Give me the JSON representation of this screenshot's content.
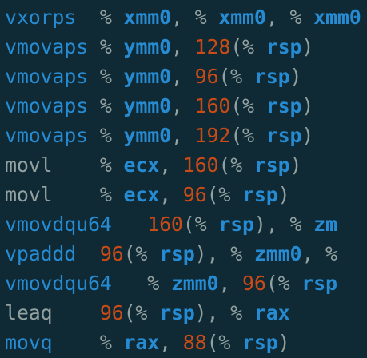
{
  "colors": {
    "background": "#0f2a34",
    "instruction": "#268bd2",
    "plain_text": "#93a1a1",
    "register": "#268bd2",
    "number": "#cb4b16"
  },
  "lines": [
    {
      "tokens": [
        {
          "t": "vxorps  ",
          "k": "op"
        },
        {
          "t": "% ",
          "k": "pct"
        },
        {
          "t": "xmm0",
          "k": "reg"
        },
        {
          "t": ", ",
          "k": "plain"
        },
        {
          "t": "% ",
          "k": "pct"
        },
        {
          "t": "xmm0",
          "k": "reg"
        },
        {
          "t": ", ",
          "k": "plain"
        },
        {
          "t": "% ",
          "k": "pct"
        },
        {
          "t": "xmm0",
          "k": "reg"
        }
      ]
    },
    {
      "tokens": [
        {
          "t": "vmovaps ",
          "k": "op"
        },
        {
          "t": "% ",
          "k": "pct"
        },
        {
          "t": "ymm0",
          "k": "reg"
        },
        {
          "t": ", ",
          "k": "plain"
        },
        {
          "t": "128",
          "k": "num"
        },
        {
          "t": "(% ",
          "k": "pct"
        },
        {
          "t": "rsp",
          "k": "reg"
        },
        {
          "t": ")",
          "k": "plain"
        }
      ]
    },
    {
      "tokens": [
        {
          "t": "vmovaps ",
          "k": "op"
        },
        {
          "t": "% ",
          "k": "pct"
        },
        {
          "t": "ymm0",
          "k": "reg"
        },
        {
          "t": ", ",
          "k": "plain"
        },
        {
          "t": "96",
          "k": "num"
        },
        {
          "t": "(% ",
          "k": "pct"
        },
        {
          "t": "rsp",
          "k": "reg"
        },
        {
          "t": ")",
          "k": "plain"
        }
      ]
    },
    {
      "tokens": [
        {
          "t": "vmovaps ",
          "k": "op"
        },
        {
          "t": "% ",
          "k": "pct"
        },
        {
          "t": "ymm0",
          "k": "reg"
        },
        {
          "t": ", ",
          "k": "plain"
        },
        {
          "t": "160",
          "k": "num"
        },
        {
          "t": "(% ",
          "k": "pct"
        },
        {
          "t": "rsp",
          "k": "reg"
        },
        {
          "t": ")",
          "k": "plain"
        }
      ]
    },
    {
      "tokens": [
        {
          "t": "vmovaps ",
          "k": "op"
        },
        {
          "t": "% ",
          "k": "pct"
        },
        {
          "t": "ymm0",
          "k": "reg"
        },
        {
          "t": ", ",
          "k": "plain"
        },
        {
          "t": "192",
          "k": "num"
        },
        {
          "t": "(% ",
          "k": "pct"
        },
        {
          "t": "rsp",
          "k": "reg"
        },
        {
          "t": ")",
          "k": "plain"
        }
      ]
    },
    {
      "tokens": [
        {
          "t": "movl    ",
          "k": "plain"
        },
        {
          "t": "% ",
          "k": "pct"
        },
        {
          "t": "ecx",
          "k": "reg"
        },
        {
          "t": ", ",
          "k": "plain"
        },
        {
          "t": "160",
          "k": "num"
        },
        {
          "t": "(% ",
          "k": "pct"
        },
        {
          "t": "rsp",
          "k": "reg"
        },
        {
          "t": ")",
          "k": "plain"
        }
      ]
    },
    {
      "tokens": [
        {
          "t": "movl    ",
          "k": "plain"
        },
        {
          "t": "% ",
          "k": "pct"
        },
        {
          "t": "ecx",
          "k": "reg"
        },
        {
          "t": ", ",
          "k": "plain"
        },
        {
          "t": "96",
          "k": "num"
        },
        {
          "t": "(% ",
          "k": "pct"
        },
        {
          "t": "rsp",
          "k": "reg"
        },
        {
          "t": ")",
          "k": "plain"
        }
      ]
    },
    {
      "tokens": [
        {
          "t": "vmovdqu64   ",
          "k": "op"
        },
        {
          "t": "160",
          "k": "num"
        },
        {
          "t": "(% ",
          "k": "pct"
        },
        {
          "t": "rsp",
          "k": "reg"
        },
        {
          "t": "), ",
          "k": "plain"
        },
        {
          "t": "% ",
          "k": "pct"
        },
        {
          "t": "zm",
          "k": "reg"
        }
      ]
    },
    {
      "tokens": [
        {
          "t": "vpaddd  ",
          "k": "op"
        },
        {
          "t": "96",
          "k": "num"
        },
        {
          "t": "(% ",
          "k": "pct"
        },
        {
          "t": "rsp",
          "k": "reg"
        },
        {
          "t": "), ",
          "k": "plain"
        },
        {
          "t": "% ",
          "k": "pct"
        },
        {
          "t": "zmm0",
          "k": "reg"
        },
        {
          "t": ", ",
          "k": "plain"
        },
        {
          "t": "%",
          "k": "pct"
        }
      ]
    },
    {
      "tokens": [
        {
          "t": "vmovdqu64   ",
          "k": "op"
        },
        {
          "t": "% ",
          "k": "pct"
        },
        {
          "t": "zmm0",
          "k": "reg"
        },
        {
          "t": ", ",
          "k": "plain"
        },
        {
          "t": "96",
          "k": "num"
        },
        {
          "t": "(% ",
          "k": "pct"
        },
        {
          "t": "rsp",
          "k": "reg"
        }
      ]
    },
    {
      "tokens": [
        {
          "t": "leaq    ",
          "k": "plain"
        },
        {
          "t": "96",
          "k": "num"
        },
        {
          "t": "(% ",
          "k": "pct"
        },
        {
          "t": "rsp",
          "k": "reg"
        },
        {
          "t": "), ",
          "k": "plain"
        },
        {
          "t": "% ",
          "k": "pct"
        },
        {
          "t": "rax",
          "k": "reg"
        }
      ]
    },
    {
      "tokens": [
        {
          "t": "movq    ",
          "k": "op"
        },
        {
          "t": "% ",
          "k": "pct"
        },
        {
          "t": "rax",
          "k": "reg"
        },
        {
          "t": ", ",
          "k": "plain"
        },
        {
          "t": "88",
          "k": "num"
        },
        {
          "t": "(% ",
          "k": "pct"
        },
        {
          "t": "rsp",
          "k": "reg"
        },
        {
          "t": ")",
          "k": "plain"
        }
      ]
    }
  ]
}
